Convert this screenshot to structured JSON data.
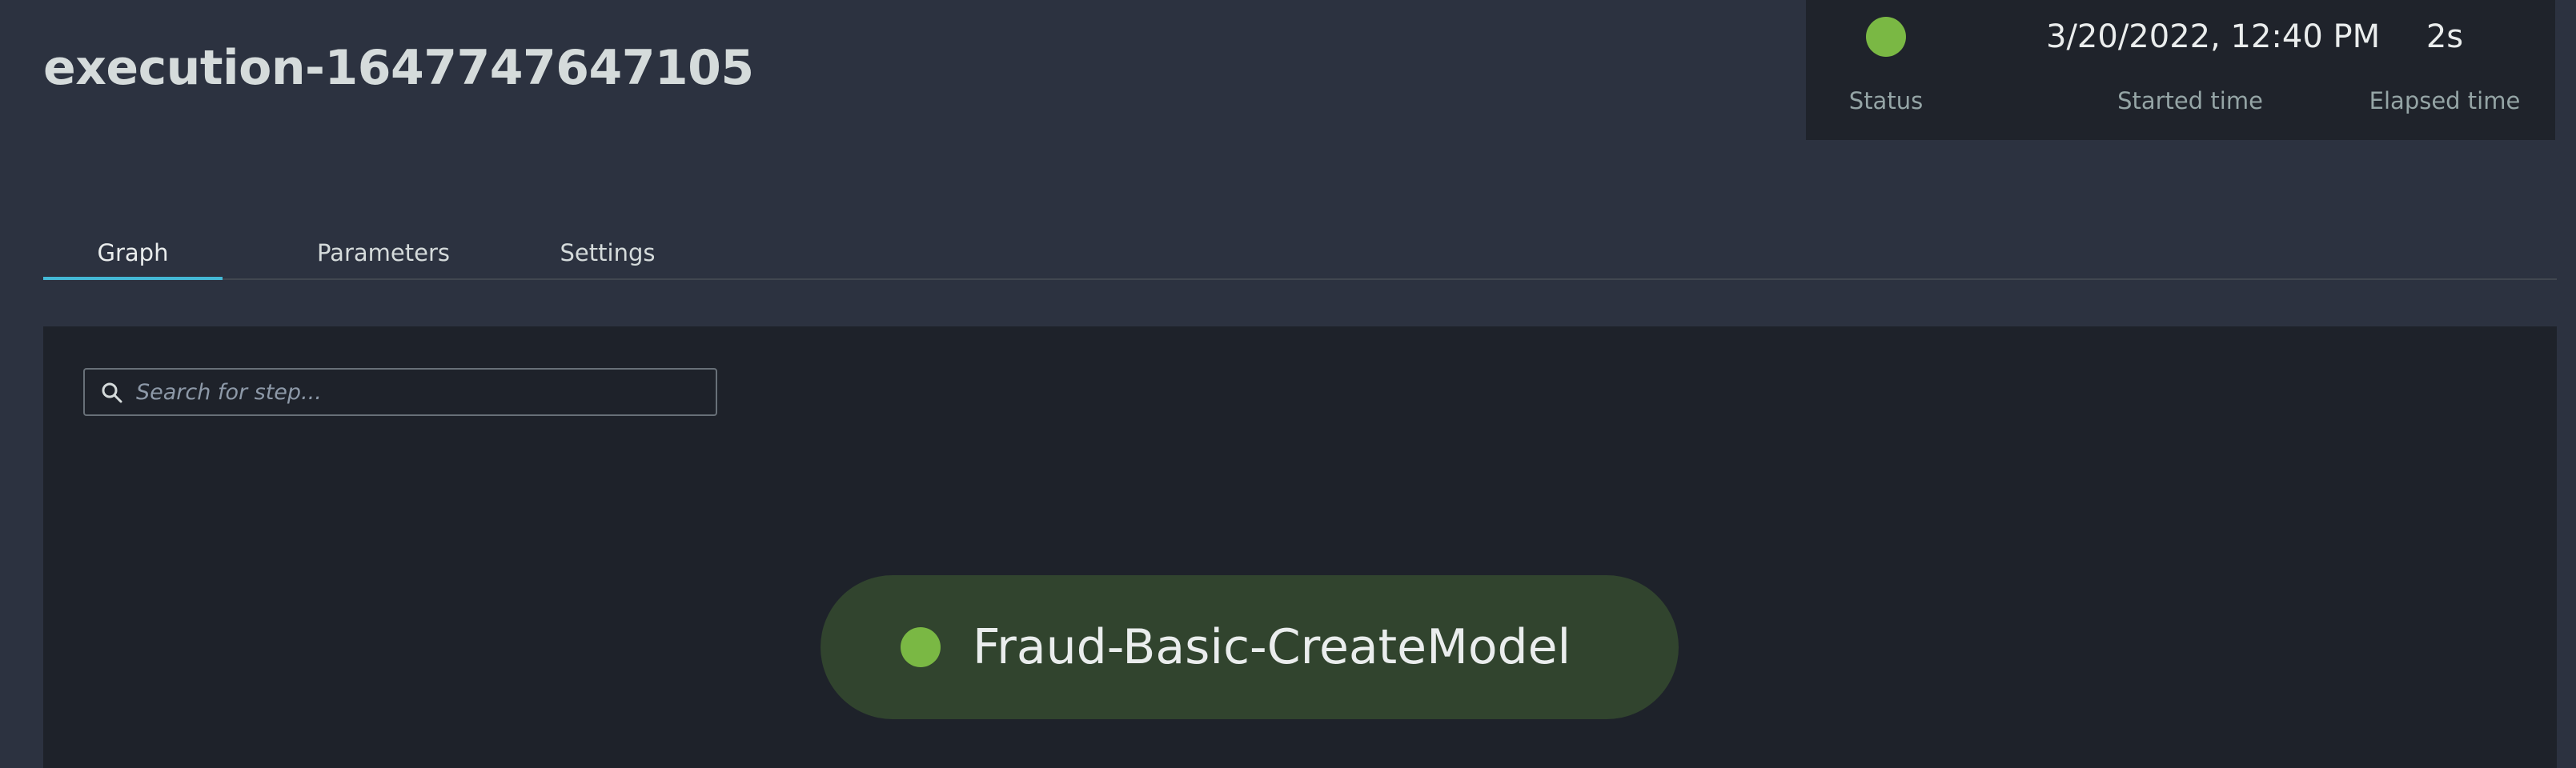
{
  "header": {
    "title": "execution-1647747647105"
  },
  "summary": {
    "status": {
      "label": "Status",
      "state": "succeeded",
      "color": "#7ab844"
    },
    "started": {
      "value": "3/20/2022, 12:40 PM",
      "label": "Started time"
    },
    "elapsed": {
      "value": "2s",
      "label": "Elapsed time"
    }
  },
  "tabs": [
    {
      "label": "Graph",
      "active": true
    },
    {
      "label": "Parameters",
      "active": false
    },
    {
      "label": "Settings",
      "active": false
    }
  ],
  "graph": {
    "search": {
      "placeholder": "Search for step...",
      "value": "",
      "icon": "search-icon"
    },
    "steps": [
      {
        "label": "Fraud-Basic-CreateModel",
        "status": "succeeded",
        "color": "#7ab844"
      }
    ]
  },
  "colors": {
    "accent": "#44b9d6",
    "success": "#7ab844",
    "node_background": "#31442e"
  }
}
